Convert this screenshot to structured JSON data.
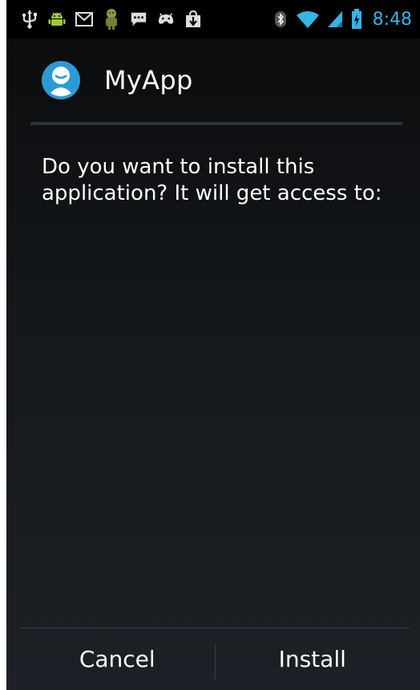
{
  "status_bar": {
    "time": "8:48",
    "accent_color": "#33b5e5",
    "icons": [
      "usb-icon",
      "android-icon",
      "gmail-icon",
      "android-alt-icon",
      "chat-icon",
      "game-controller-icon",
      "download-icon",
      "bluetooth-icon",
      "wifi-icon",
      "signal-icon",
      "battery-charging-icon"
    ]
  },
  "dialog": {
    "app_name": "MyApp",
    "app_icon": "app-face-icon",
    "message": "Do you want to install this\napplication? It will get access to:",
    "buttons": {
      "cancel_label": "Cancel",
      "install_label": "Install"
    }
  }
}
